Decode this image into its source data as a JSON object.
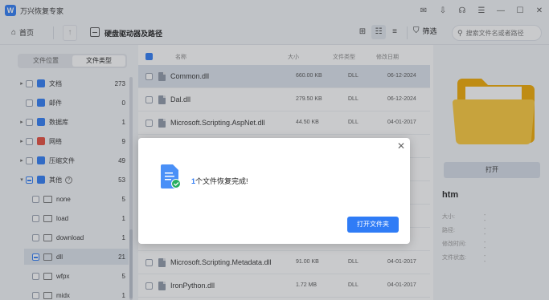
{
  "app": {
    "title": "万兴恢复专家",
    "logo_glyph": "W"
  },
  "window_controls": [
    "✉",
    "⇩",
    "☊",
    "☰",
    "—",
    "☐",
    "✕"
  ],
  "toolbar": {
    "home_label": "首页",
    "path_label": "硬盘驱动器及路径",
    "filter_label": "筛选",
    "search_placeholder": "搜索文件名或者路径"
  },
  "left_panel": {
    "tabs": [
      "文件位置",
      "文件类型"
    ],
    "active_tab": 1,
    "tree": [
      {
        "label": "文档",
        "count": "273",
        "caret": "▸",
        "icon": "document",
        "color": "#2f7cf6"
      },
      {
        "label": "邮件",
        "count": "0",
        "caret": "",
        "icon": "mail",
        "color": "#2f7cf6"
      },
      {
        "label": "数据库",
        "count": "1",
        "caret": "▸",
        "icon": "database",
        "color": "#2f7cf6"
      },
      {
        "label": "网络",
        "count": "9",
        "caret": "▸",
        "icon": "network",
        "color": "#e74c3c"
      },
      {
        "label": "压缩文件",
        "count": "49",
        "caret": "▸",
        "icon": "archive",
        "color": "#2f7cf6"
      },
      {
        "label": "其他",
        "count": "53",
        "caret": "▾",
        "icon": "other",
        "color": "#2f7cf6"
      },
      {
        "label": "none",
        "count": "5",
        "caret": "",
        "icon": "folder",
        "color": "#777"
      },
      {
        "label": "load",
        "count": "1",
        "caret": "",
        "icon": "folder",
        "color": "#777"
      },
      {
        "label": "download",
        "count": "1",
        "caret": "",
        "icon": "folder",
        "color": "#777"
      },
      {
        "label": "dll",
        "count": "21",
        "caret": "",
        "icon": "folder",
        "color": "#777"
      },
      {
        "label": "wfpx",
        "count": "5",
        "caret": "",
        "icon": "folder",
        "color": "#777"
      },
      {
        "label": "midx",
        "count": "1",
        "caret": "",
        "icon": "folder",
        "color": "#777"
      }
    ]
  },
  "file_list": {
    "headers": {
      "name": "名称",
      "size": "大小",
      "type": "文件类型",
      "date": "修改日期"
    },
    "rows": [
      {
        "name": "Common.dll",
        "size": "660.00 KB",
        "type": "DLL",
        "date": "06-12-2024"
      },
      {
        "name": "Dal.dll",
        "size": "279.50 KB",
        "type": "DLL",
        "date": "06-12-2024"
      },
      {
        "name": "Microsoft.Scripting.AspNet.dll",
        "size": "44.50 KB",
        "type": "DLL",
        "date": "04-01-2017"
      },
      {
        "name": "",
        "size": "",
        "type": "",
        "date": "-2017"
      },
      {
        "name": "",
        "size": "",
        "type": "",
        "date": "-2017"
      },
      {
        "name": "",
        "size": "",
        "type": "",
        "date": "-2017"
      },
      {
        "name": "",
        "size": "",
        "type": "",
        "date": "-2017"
      },
      {
        "name": "",
        "size": "",
        "type": "",
        "date": "-2017"
      },
      {
        "name": "Microsoft.Scripting.Metadata.dll",
        "size": "91.00 KB",
        "type": "DLL",
        "date": "04-01-2017"
      },
      {
        "name": "IronPython.dll",
        "size": "1.72 MB",
        "type": "DLL",
        "date": "04-01-2017"
      }
    ]
  },
  "preview": {
    "open_label": "打开",
    "name": "htm",
    "meta": [
      {
        "label": "大小:",
        "value": "--"
      },
      {
        "label": "路径:",
        "value": "--"
      },
      {
        "label": "修改时间:",
        "value": "--"
      },
      {
        "label": "文件状态:",
        "value": "--"
      }
    ]
  },
  "modal": {
    "count": "1",
    "message": "个文件恢复完成!",
    "open_folder_label": "打开文件夹",
    "close_glyph": "✕"
  },
  "colors": {
    "accent": "#2f7cf6",
    "folder": "#f7b731",
    "success": "#27ae60"
  }
}
